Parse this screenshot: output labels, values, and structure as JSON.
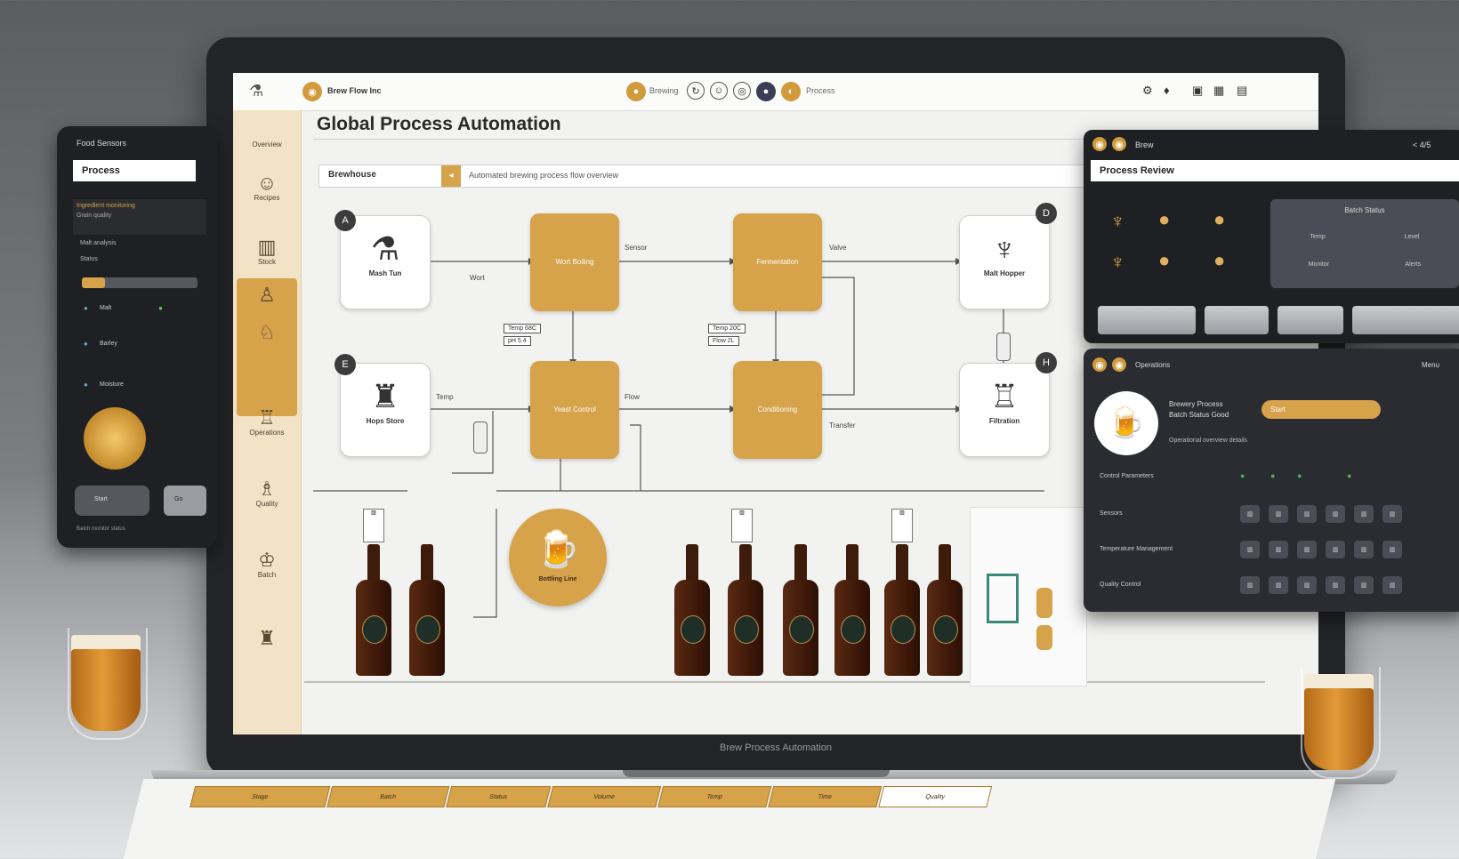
{
  "app": {
    "brand": "Brew Flow Inc",
    "page_title": "Global Process Automation",
    "bezel_caption": "Brew Process Automation"
  },
  "header": {
    "center_badge_1": "Brewing",
    "center_badge_2": "Process",
    "icons": [
      "settings-icon",
      "bell-icon",
      "user-icon",
      "grid-icon",
      "menu-icon"
    ]
  },
  "sidebar": {
    "items": [
      {
        "label": "Overview",
        "icon": "home-icon"
      },
      {
        "label": "Recipes",
        "icon": "recipe-icon"
      },
      {
        "label": "Stock",
        "icon": "stock-icon"
      },
      {
        "label": "Operations",
        "icon": "operations-icon"
      },
      {
        "label": "Quality",
        "icon": "quality-icon"
      },
      {
        "label": "Batch",
        "icon": "batch-icon"
      }
    ]
  },
  "filter": {
    "label": "Brewhouse",
    "text": "Automated brewing process flow overview"
  },
  "flow": {
    "nodes": [
      {
        "id": "A",
        "label": "Mash Tun"
      },
      {
        "id": "B",
        "label": "Wort Boiling"
      },
      {
        "id": "C",
        "label": "Fermentation"
      },
      {
        "id": "D",
        "label": "Malt Hopper"
      },
      {
        "id": "E",
        "label": "Hops Store"
      },
      {
        "id": "F",
        "label": "Yeast Control"
      },
      {
        "id": "G",
        "label": "Conditioning"
      },
      {
        "id": "H",
        "label": "Filtration"
      }
    ],
    "edge_labels": [
      "Wort",
      "Sensor",
      "Valve",
      "Temp",
      "Flow",
      "Transfer"
    ],
    "tags": [
      "Temp 68C",
      "pH 5.4",
      "Temp 20C",
      "Flow 2L"
    ],
    "bottle_station": "Bottling Line"
  },
  "left_tablet": {
    "title": "Food Sensors",
    "header": "Process",
    "lines": [
      "Ingredient monitoring",
      "Grain quality",
      "Malt analysis",
      "Status"
    ],
    "items": [
      "Malt",
      "Barley",
      "Moisture"
    ],
    "buttons": [
      "Start",
      "Go"
    ],
    "footer": "Batch monitor status"
  },
  "right_panel_1": {
    "title": "Brew",
    "header": "Process Review",
    "top_right": "< 4/5",
    "card_title": "Batch Status",
    "card_rows": [
      "Temp",
      "Level"
    ],
    "card_footer": [
      "Monitor",
      "Alerts"
    ]
  },
  "right_panel_2": {
    "title": "Operations",
    "top_right": "Menu",
    "info_line1": "Brewery Process",
    "info_line2": "Batch Status Good",
    "cta": "Start",
    "desc": "Operational overview details",
    "rows": [
      "Control Parameters",
      "Sensors",
      "Temperature Management",
      "Quality Control"
    ]
  },
  "bottom_table": {
    "cells": [
      "Stage",
      "Batch",
      "Status",
      "Volume",
      "Temp",
      "Time",
      "Quality"
    ]
  },
  "colors": {
    "gold": "#d6a24a",
    "dark_panel": "#2c2e33",
    "sidebar": "#f3e3c6",
    "screen_bg": "#f2f2f0"
  }
}
